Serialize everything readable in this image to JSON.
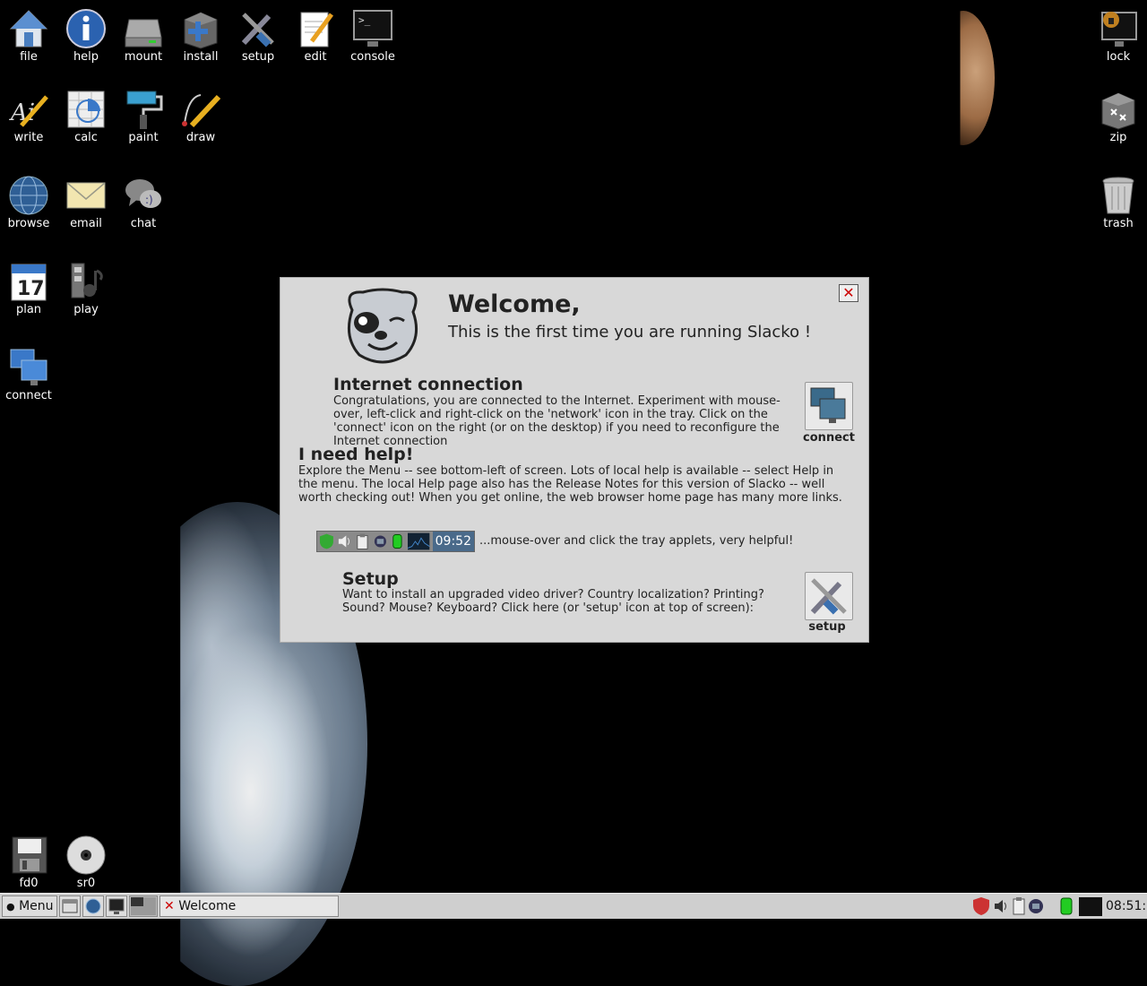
{
  "desktop": {
    "icons": [
      {
        "id": "file",
        "label": "file",
        "icon": "home-icon"
      },
      {
        "id": "help",
        "label": "help",
        "icon": "info-icon"
      },
      {
        "id": "mount",
        "label": "mount",
        "icon": "drive-icon"
      },
      {
        "id": "install",
        "label": "install",
        "icon": "package-add-icon"
      },
      {
        "id": "setup",
        "label": "setup",
        "icon": "tools-icon"
      },
      {
        "id": "edit",
        "label": "edit",
        "icon": "pencil-notepad-icon"
      },
      {
        "id": "console",
        "label": "console",
        "icon": "terminal-icon"
      },
      {
        "id": "write",
        "label": "write",
        "icon": "write-icon"
      },
      {
        "id": "calc",
        "label": "calc",
        "icon": "spreadsheet-icon"
      },
      {
        "id": "paint",
        "label": "paint",
        "icon": "paint-roller-icon"
      },
      {
        "id": "draw",
        "label": "draw",
        "icon": "draw-icon"
      },
      {
        "id": "browse",
        "label": "browse",
        "icon": "globe-icon"
      },
      {
        "id": "email",
        "label": "email",
        "icon": "envelope-icon"
      },
      {
        "id": "chat",
        "label": "chat",
        "icon": "chat-bubbles-icon"
      },
      {
        "id": "plan",
        "label": "plan",
        "icon": "calendar-icon",
        "value": "17"
      },
      {
        "id": "play",
        "label": "play",
        "icon": "media-icon"
      },
      {
        "id": "connect",
        "label": "connect",
        "icon": "network-monitors-icon"
      },
      {
        "id": "lock",
        "label": "lock",
        "icon": "lock-screen-icon"
      },
      {
        "id": "zip",
        "label": "zip",
        "icon": "archive-box-icon"
      },
      {
        "id": "trash",
        "label": "trash",
        "icon": "trash-icon"
      },
      {
        "id": "fd0",
        "label": "fd0",
        "icon": "floppy-icon"
      },
      {
        "id": "sr0",
        "label": "sr0",
        "icon": "cdrom-icon"
      }
    ]
  },
  "dialog": {
    "title": "Welcome,",
    "subtitle": "This is the first time you are running Slacko !",
    "internet_heading": "Internet connection",
    "internet_body": "Congratulations, you are connected to the Internet. Experiment with mouse-over, left-click and right-click on the 'network' icon in the tray. Click on the 'connect' icon on the right (or on the desktop) if you need to reconfigure the Internet connection",
    "connect_label": "connect",
    "help_heading": "I need help!",
    "help_body": "Explore the Menu -- see bottom-left of screen. Lots of local help is available -- select Help in the menu. The local Help page also has the Release Notes for this version of Slacko -- well worth checking out! When you get online, the web browser home page has many more links.",
    "tray_time": "09:52",
    "tray_hint": "...mouse-over and click the tray applets, very helpful!",
    "setup_heading": "Setup",
    "setup_body": "Want to install an upgraded video driver? Country localization? Printing? Sound? Mouse? Keyboard? Click here (or 'setup' icon at top of screen):",
    "setup_label": "setup",
    "close_glyph": "✕"
  },
  "taskbar": {
    "menu_label": "Menu",
    "window_label": "Welcome",
    "clock": "08:51:"
  }
}
